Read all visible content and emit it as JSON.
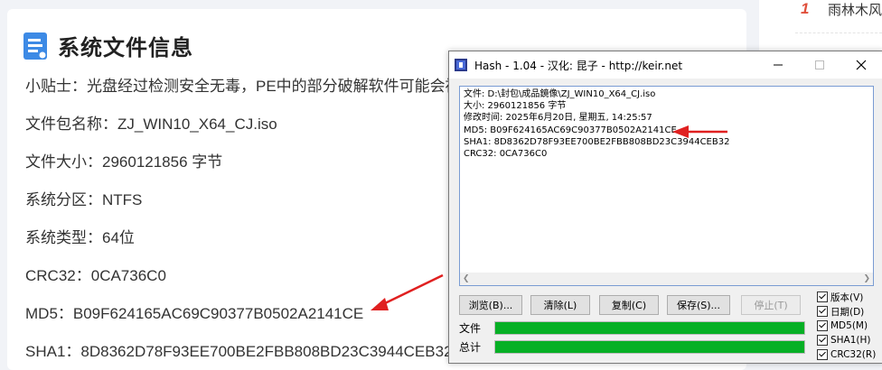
{
  "article": {
    "title": "系统文件信息",
    "lines": {
      "tip": "小贴士：光盘经过检测安全无毒，PE中的部分破解软件可能会被",
      "filename": "文件包名称：ZJ_WIN10_X64_CJ.iso",
      "filesize": "文件大小：2960121856 字节",
      "partition": "系统分区：NTFS",
      "systype": "系统类型：64位",
      "crc32": "CRC32：0CA736C0",
      "md5": "MD5：B09F624165AC69C90377B0502A2141CE",
      "sha1": "SHA1：8D8362D78F93EE700BE2FBB808BD23C3944CEB32"
    }
  },
  "sidebar": {
    "rank": "1",
    "title": "雨林木风"
  },
  "hash_window": {
    "title": "Hash - 1.04 - 汉化: 昆子 - http://keir.net",
    "output": {
      "file": "文件: D:\\封包\\成品鏡像\\ZJ_WIN10_X64_CJ.iso",
      "size": "大小: 2960121856 字节",
      "mtime": "修改时间: 2025年6月20日, 星期五, 14:25:57",
      "md5": "MD5: B09F624165AC69C90377B0502A2141CE",
      "sha1": "SHA1: 8D8362D78F93EE700BE2FBB808BD23C3944CEB32",
      "crc32": "CRC32: 0CA736C0"
    },
    "buttons": {
      "browse": "浏览(B)...",
      "clear": "清除(L)",
      "copy": "复制(C)",
      "save": "保存(S)...",
      "stop": "停止(T)"
    },
    "progress": {
      "file_label": "文件",
      "file_value": 1.0,
      "total_label": "总计",
      "total_value": 1.0
    },
    "options": {
      "version": "版本(V)",
      "date": "日期(D)",
      "md5": "MD5(M)",
      "sha1": "SHA1(H)",
      "crc32": "CRC32(R)"
    }
  },
  "colors": {
    "accent_arrow": "#e02020",
    "progress_green": "#06b025",
    "icon_blue": "#3d8ae5",
    "rank_red": "#e0503c"
  }
}
